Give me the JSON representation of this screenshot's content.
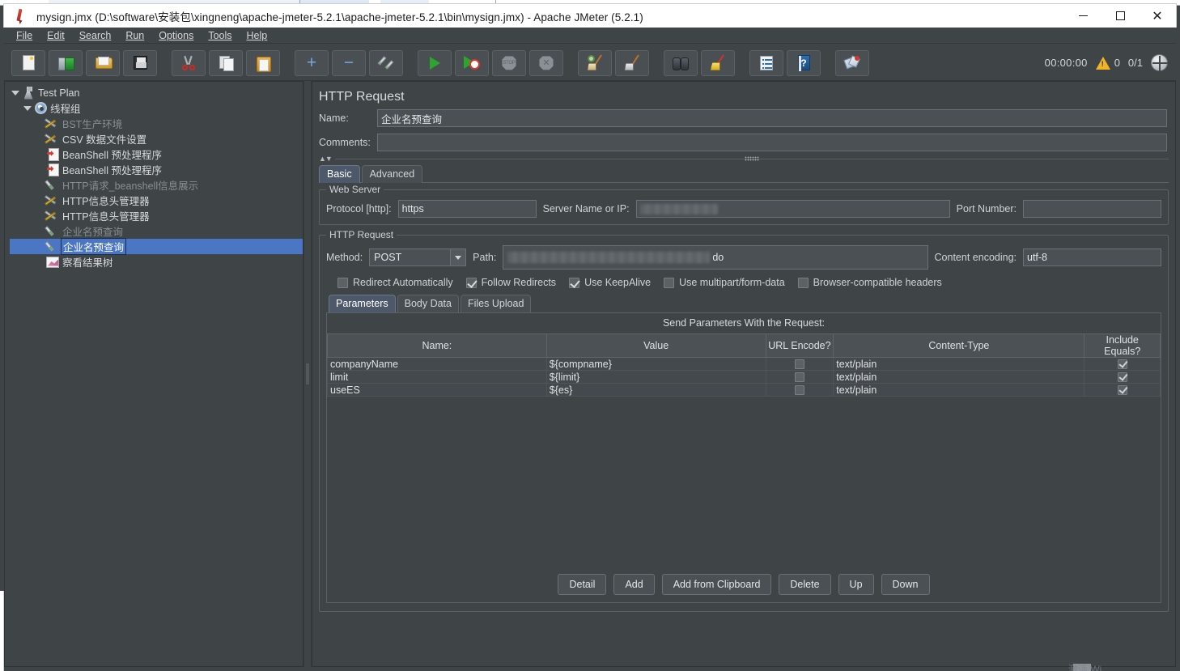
{
  "window": {
    "title": "mysign.jmx (D:\\software\\安装包\\xingneng\\apache-jmeter-5.2.1\\apache-jmeter-5.2.1\\bin\\mysign.jmx) - Apache JMeter (5.2.1)",
    "app_icon": "jmeter-feather-icon",
    "minimize_label": "Minimize",
    "maximize_label": "Maximize",
    "close_label": "Close",
    "accent_selected": "#4a76c4",
    "background": "#3f4447"
  },
  "menubar": {
    "items": [
      {
        "label": "File"
      },
      {
        "label": "Edit"
      },
      {
        "label": "Search"
      },
      {
        "label": "Run"
      },
      {
        "label": "Options"
      },
      {
        "label": "Tools"
      },
      {
        "label": "Help"
      }
    ]
  },
  "toolbar": {
    "buttons": [
      {
        "name": "new-button",
        "icon": "new-page-icon"
      },
      {
        "name": "templates-button",
        "icon": "templates-icon"
      },
      {
        "name": "open-button",
        "icon": "open-folder-icon"
      },
      {
        "name": "save-button",
        "icon": "save-floppy-icon"
      },
      {
        "name": "cut-button",
        "icon": "scissors-icon"
      },
      {
        "name": "copy-button",
        "icon": "copy-icon"
      },
      {
        "name": "paste-button",
        "icon": "clipboard-paste-icon"
      },
      {
        "name": "expand-all-button",
        "icon": "plus-icon"
      },
      {
        "name": "collapse-all-button",
        "icon": "minus-icon"
      },
      {
        "name": "toggle-button",
        "icon": "toggle-icon"
      },
      {
        "name": "start-button",
        "icon": "play-icon"
      },
      {
        "name": "start-no-pauses-button",
        "icon": "play-no-pauses-icon"
      },
      {
        "name": "stop-button",
        "icon": "stop-icon"
      },
      {
        "name": "shutdown-button",
        "icon": "shutdown-icon"
      },
      {
        "name": "clear-button",
        "icon": "clear-broom-gear-icon"
      },
      {
        "name": "clear-all-button",
        "icon": "clear-all-broom-icon"
      },
      {
        "name": "search-button",
        "icon": "binoculars-icon"
      },
      {
        "name": "reset-search-button",
        "icon": "yellow-broom-icon"
      },
      {
        "name": "function-helper-button",
        "icon": "notes-icon"
      },
      {
        "name": "help-button",
        "icon": "help-book-icon"
      },
      {
        "name": "undo-redo-button",
        "icon": "fan-icon"
      }
    ],
    "status": {
      "elapsed_time": "00:00:00",
      "warning_icon": "warning-triangle-icon",
      "warning_count": "0",
      "threads": "0/1",
      "remote_icon": "globe-icon"
    }
  },
  "tree": {
    "items": [
      {
        "label": "Test Plan",
        "depth": 0,
        "icon": "test-plan-icon",
        "expanded": true,
        "disabled": false,
        "selected": false
      },
      {
        "label": "线程组",
        "depth": 1,
        "icon": "thread-group-icon",
        "expanded": true,
        "disabled": false,
        "selected": false
      },
      {
        "label": "BST生产环境",
        "depth": 2,
        "icon": "config-element-icon",
        "expanded": null,
        "disabled": true,
        "selected": false
      },
      {
        "label": "CSV 数据文件设置",
        "depth": 2,
        "icon": "config-element-icon",
        "expanded": null,
        "disabled": false,
        "selected": false
      },
      {
        "label": "BeanShell 预处理程序",
        "depth": 2,
        "icon": "beanshell-icon",
        "expanded": null,
        "disabled": false,
        "selected": false
      },
      {
        "label": "BeanShell 预处理程序",
        "depth": 2,
        "icon": "beanshell-icon",
        "expanded": null,
        "disabled": false,
        "selected": false
      },
      {
        "label": "HTTP请求_beanshell信息展示",
        "depth": 2,
        "icon": "http-sampler-icon",
        "expanded": null,
        "disabled": true,
        "selected": false
      },
      {
        "label": "HTTP信息头管理器",
        "depth": 2,
        "icon": "config-element-icon",
        "expanded": null,
        "disabled": false,
        "selected": false
      },
      {
        "label": "HTTP信息头管理器",
        "depth": 2,
        "icon": "config-element-icon",
        "expanded": null,
        "disabled": false,
        "selected": false
      },
      {
        "label": "企业名预查询",
        "depth": 2,
        "icon": "http-sampler-icon",
        "expanded": null,
        "disabled": true,
        "selected": false
      },
      {
        "label": "企业名预查询",
        "depth": 2,
        "icon": "http-sampler-icon",
        "expanded": null,
        "disabled": false,
        "selected": true
      },
      {
        "label": "察看结果树",
        "depth": 2,
        "icon": "view-results-tree-icon",
        "expanded": null,
        "disabled": false,
        "selected": false
      }
    ]
  },
  "main": {
    "title": "HTTP Request",
    "name_label": "Name:",
    "name_value": "企业名预查询",
    "comments_label": "Comments:",
    "comments_value": "",
    "tabs": [
      {
        "label": "Basic",
        "active": true
      },
      {
        "label": "Advanced",
        "active": false
      }
    ],
    "web_server": {
      "legend": "Web Server",
      "protocol_label": "Protocol [http]:",
      "protocol_value": "https",
      "server_label": "Server Name or IP:",
      "server_value": "",
      "server_redacted": true,
      "port_label": "Port Number:",
      "port_value": ""
    },
    "http_request": {
      "legend": "HTTP Request",
      "method_label": "Method:",
      "method_value": "POST",
      "path_label": "Path:",
      "path_value": "",
      "path_redacted": true,
      "path_tail": "do",
      "encoding_label": "Content encoding:",
      "encoding_value": "utf-8"
    },
    "options": [
      {
        "label": "Redirect Automatically",
        "checked": false
      },
      {
        "label": "Follow Redirects",
        "checked": true
      },
      {
        "label": "Use KeepAlive",
        "checked": true
      },
      {
        "label": "Use multipart/form-data",
        "checked": false
      },
      {
        "label": "Browser-compatible headers",
        "checked": false
      }
    ],
    "param_tabs": [
      {
        "label": "Parameters",
        "active": true
      },
      {
        "label": "Body Data",
        "active": false
      },
      {
        "label": "Files Upload",
        "active": false
      }
    ],
    "params": {
      "caption": "Send Parameters With the Request:",
      "columns": [
        "Name:",
        "Value",
        "URL Encode?",
        "Content-Type",
        "Include Equals?"
      ],
      "rows": [
        {
          "name": "companyName",
          "value": "${compname}",
          "url_encode": false,
          "content_type": "text/plain",
          "include_equals": true
        },
        {
          "name": "limit",
          "value": "${limit}",
          "url_encode": false,
          "content_type": "text/plain",
          "include_equals": true
        },
        {
          "name": "useES",
          "value": "${es}",
          "url_encode": false,
          "content_type": "text/plain",
          "include_equals": true
        }
      ]
    },
    "buttons": [
      {
        "label": "Detail"
      },
      {
        "label": "Add"
      },
      {
        "label": "Add from Clipboard"
      },
      {
        "label": "Delete"
      },
      {
        "label": "Up"
      },
      {
        "label": "Down"
      }
    ]
  },
  "watermark": {
    "text": "激活 Wi..."
  }
}
